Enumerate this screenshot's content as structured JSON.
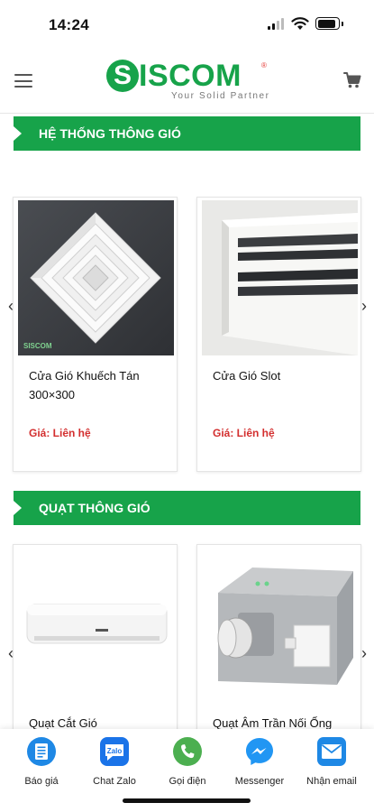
{
  "status_bar": {
    "time": "14:24",
    "battery_level": 0.9
  },
  "header": {
    "logo_text": "ISCOM",
    "logo_letter": "S",
    "logo_tagline": "Your  Solid  Partner",
    "logo_reg": "®"
  },
  "sections": [
    {
      "title": "HỆ THỐNG THÔNG GIÓ",
      "products": [
        {
          "name": "Cửa Gió Khuếch Tán 300×300",
          "price": "Giá: Liên hệ",
          "image_watermark": "SISCOM"
        },
        {
          "name": "Cửa Gió Slot",
          "price": "Giá: Liên hệ"
        }
      ]
    },
    {
      "title": "QUẠT THÔNG GIÓ",
      "products": [
        {
          "name": "Quạt Cắt Gió"
        },
        {
          "name": "Quạt Âm Trần Nối Ống"
        }
      ]
    }
  ],
  "bottom_nav": [
    {
      "label": "Báo giá",
      "icon": "price-list-icon",
      "color": "#1e88e5"
    },
    {
      "label": "Chat Zalo",
      "icon": "zalo-icon",
      "color": "#1a73e8"
    },
    {
      "label": "Gọi điện",
      "icon": "phone-icon",
      "color": "#4caf50"
    },
    {
      "label": "Messenger",
      "icon": "messenger-icon",
      "color": "#2196f3"
    },
    {
      "label": "Nhận email",
      "icon": "email-icon",
      "color": "#1e88e5"
    }
  ],
  "colors": {
    "brand": "#17a34a",
    "price": "#d32f2f"
  }
}
